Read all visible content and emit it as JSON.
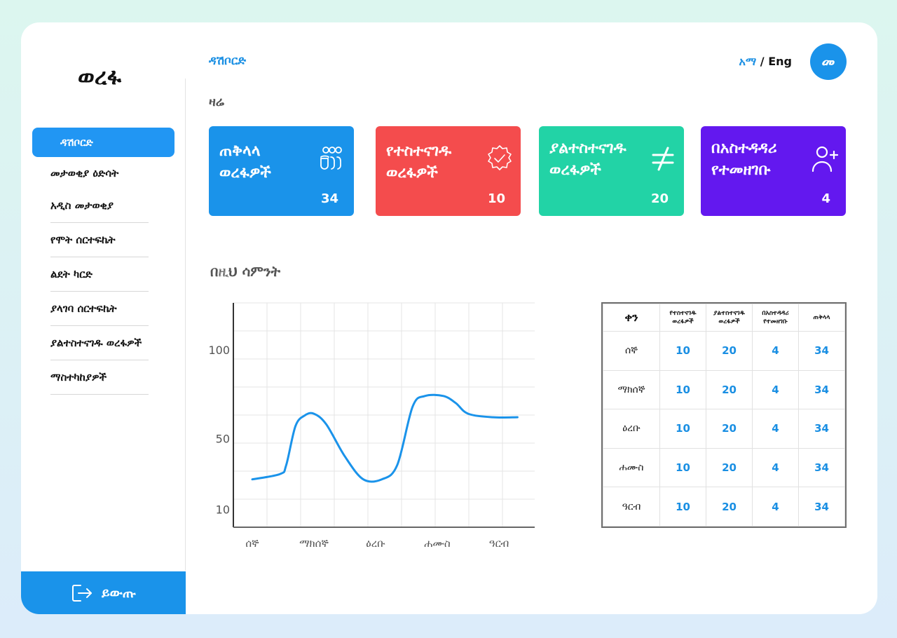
{
  "app": {
    "logo": "ወረፋ"
  },
  "sidebar": {
    "items": [
      {
        "label": "ዳሽቦርድ"
      },
      {
        "label": "መታወቂያ ዕድሳት"
      },
      {
        "label": "አዲስ መታወቂያ"
      },
      {
        "label": "የሞት ሰርተፍኬት"
      },
      {
        "label": "ልደት ካርድ"
      },
      {
        "label": "ያላገባ ሰርተፍኬት"
      },
      {
        "label": "ያልተስተናገዱ ወረፋዎች"
      },
      {
        "label": "ማስተካከያዎች"
      }
    ],
    "logout": "ይውጡ"
  },
  "header": {
    "breadcrumb": "ዳሽቦርድ",
    "lang_am": "አማ",
    "lang_sep": " / ",
    "lang_en": "Eng",
    "avatar": "መ"
  },
  "today": {
    "title": "ዛሬ",
    "cards": [
      {
        "title": "ጠቅላላ ወረፋዎች",
        "count": "34",
        "color": "#1a93ea",
        "icon": "people-icon"
      },
      {
        "title": "የተስተናገዱ ወረፋዎች",
        "count": "10",
        "color": "#f44c4d",
        "icon": "verified-badge-icon"
      },
      {
        "title": "ያልተስተናገዱ ወረፋዎች",
        "count": "20",
        "color": "#22d3a6",
        "icon": "not-equal-icon"
      },
      {
        "title": "በአስተዳዳሪ የተመዘገቡ",
        "count": "4",
        "color": "#6318ef",
        "icon": "add-user-icon"
      }
    ]
  },
  "week": {
    "title": "በዚህ ሳምንት"
  },
  "chart_data": {
    "type": "line",
    "categories": [
      "ሰኞ",
      "ማክሰኞ",
      "ዕረቡ",
      "ሐሙስ",
      "ዓርብ"
    ],
    "yticks": [
      10,
      50,
      100
    ],
    "points": [
      [
        0.0,
        27
      ],
      [
        0.45,
        30
      ],
      [
        0.55,
        35
      ],
      [
        0.7,
        57
      ],
      [
        0.85,
        63
      ],
      [
        1.0,
        64
      ],
      [
        1.2,
        58
      ],
      [
        1.5,
        40
      ],
      [
        1.8,
        27
      ],
      [
        2.1,
        27
      ],
      [
        2.35,
        35
      ],
      [
        2.6,
        68
      ],
      [
        2.8,
        74
      ],
      [
        3.1,
        74
      ],
      [
        3.3,
        70
      ],
      [
        3.5,
        64
      ],
      [
        3.9,
        62
      ],
      [
        4.3,
        62
      ]
    ],
    "line_color": "#1a93ea",
    "grid": true
  },
  "table": {
    "headers": [
      "ቀን",
      "የተስተናገዱ ወረፋዎች",
      "ያልተስተናገዱ ወረፋዎች",
      "በአስተዳዳሪ የተመዘገቡ",
      "ጠቅላላ"
    ],
    "rows": [
      [
        "ሰኞ",
        "10",
        "20",
        "4",
        "34"
      ],
      [
        "ማክሰኞ",
        "10",
        "20",
        "4",
        "34"
      ],
      [
        "ዕረቡ",
        "10",
        "20",
        "4",
        "34"
      ],
      [
        "ሐሙስ",
        "10",
        "20",
        "4",
        "34"
      ],
      [
        "ዓርብ",
        "10",
        "20",
        "4",
        "34"
      ]
    ]
  }
}
